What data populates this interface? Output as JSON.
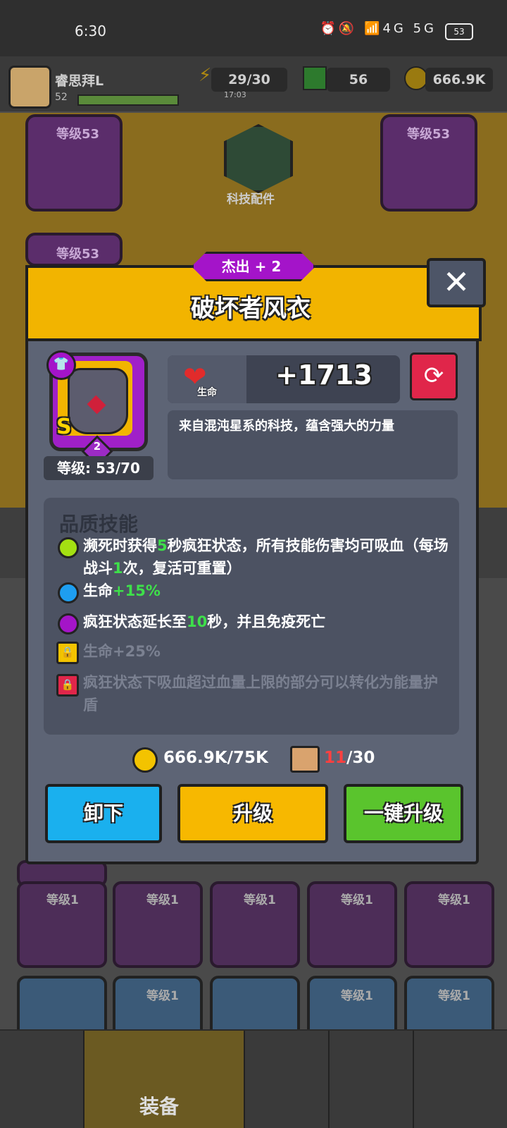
{
  "status_bar": {
    "time": "6:30",
    "icons": "⏰🔕 📶4G 5G",
    "battery": "53"
  },
  "player": {
    "name": "睿思拜L",
    "level": "52"
  },
  "resources": {
    "energy": "29/30",
    "energy_timer": "17:03",
    "gems": "56",
    "coins": "666.9K"
  },
  "background": {
    "slot_label_left": "等级53",
    "slot_label_right": "等级53",
    "slot_label_left2": "等级53",
    "tech_label": "科技配件",
    "grid_label": "等级1",
    "nav_label": "装备"
  },
  "modal": {
    "rarity": "杰出 + 2",
    "title": "破坏者风衣",
    "close": "✕",
    "item_rank": "S",
    "item_stars": "2",
    "level": "等级: 53/70",
    "stat_name": "生命",
    "stat_value": "+1713",
    "description": "来自混沌星系的科技，蕴含强大的力量",
    "quality_title": "品质技能",
    "skills": [
      {
        "pre": "濒死时获得",
        "hl": "5",
        "post": "秒疯狂状态，所有技能伤害均可吸血（每场战斗",
        "hl2": "1",
        "post2": "次，复活可重置）",
        "color": "#a4e012"
      },
      {
        "pre": "生命",
        "hl": "+15%",
        "post": "",
        "color": "#1e9ef0"
      },
      {
        "pre": "疯狂状态延长至",
        "hl": "10",
        "post": "秒，并且免疫死亡",
        "color": "#a415c8"
      },
      {
        "text": "生命+25%",
        "lock_color": "#f3c300"
      },
      {
        "text": "疯狂状态下吸血超过血量上限的部分可以转化为能量护盾",
        "lock_color": "#e0264a"
      }
    ],
    "cost_coins": "666.9K/75K",
    "cost_mat_have": "11",
    "cost_mat_need": "/30",
    "buttons": {
      "unequip": "卸下",
      "upgrade": "升级",
      "oneclick": "一键升级"
    }
  },
  "colors": {
    "header": "#f2b400",
    "panel": "#5d6475",
    "rarity": "#a414c9",
    "green_text": "#3ee04a"
  }
}
